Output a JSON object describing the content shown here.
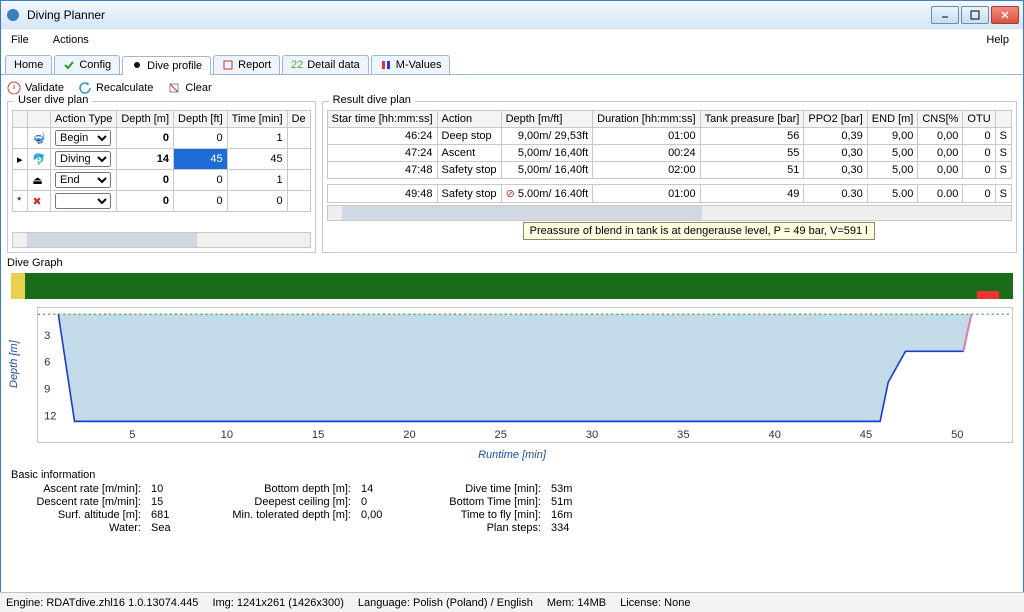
{
  "window": {
    "title": "Diving Planner"
  },
  "menu": {
    "file": "File",
    "actions": "Actions",
    "help": "Help"
  },
  "tabs": {
    "home": "Home",
    "config": "Config",
    "dive_profile": "Dive profile",
    "report": "Report",
    "detail_data": "Detail data",
    "mvalues": "M-Values"
  },
  "toolbar": {
    "validate": "Validate",
    "recalculate": "Recalculate",
    "clear": "Clear"
  },
  "user_plan": {
    "title": "User dive plan",
    "cols": {
      "action_type": "Action Type",
      "depth_m": "Depth [m]",
      "depth_ft": "Depth [ft]",
      "time_min": "Time [min]",
      "de": "De"
    },
    "rows": [
      {
        "action": "Begin",
        "depth_m": "0",
        "depth_ft": "0",
        "time": "1"
      },
      {
        "action": "Diving",
        "depth_m": "14",
        "depth_ft": "45",
        "time": "45"
      },
      {
        "action": "End",
        "depth_m": "0",
        "depth_ft": "0",
        "time": "1"
      },
      {
        "action": "",
        "depth_m": "0",
        "depth_ft": "0",
        "time": "0"
      }
    ]
  },
  "result_plan": {
    "title": "Result dive plan",
    "cols": {
      "star": "Star time [hh:mm:ss]",
      "action": "Action",
      "depth": "Depth [m/ft]",
      "duration": "Duration [hh:mm:ss]",
      "tank": "Tank preasure [bar]",
      "ppo2": "PPO2 [bar]",
      "end": "END [m]",
      "cns": "CNS[%",
      "otu": "OTU",
      "last": ""
    },
    "rows": [
      {
        "star": "46:24",
        "action": "Deep stop",
        "depth": "9,00m/ 29,53ft",
        "dur": "01:00",
        "tank": "56",
        "ppo2": "0,39",
        "end": "9,00",
        "cns": "0,00",
        "otu": "0",
        "l": "S"
      },
      {
        "star": "47:24",
        "action": "Ascent",
        "depth": "5,00m/ 16,40ft",
        "dur": "00:24",
        "tank": "55",
        "ppo2": "0,30",
        "end": "5,00",
        "cns": "0,00",
        "otu": "0",
        "l": "S"
      },
      {
        "star": "47:48",
        "action": "Safety stop",
        "depth": "5,00m/ 16,40ft",
        "dur": "02:00",
        "tank": "51",
        "ppo2": "0,30",
        "end": "5,00",
        "cns": "0,00",
        "otu": "0",
        "l": "S"
      },
      {
        "star": "49:48",
        "action": "Safety stop",
        "depth": "5.00m/ 16.40ft",
        "dur": "01:00",
        "tank": "49",
        "ppo2": "0.30",
        "end": "5.00",
        "cns": "0.00",
        "otu": "0",
        "l": "S",
        "warn": true
      }
    ]
  },
  "tooltip": "Preassure of blend in tank is at dengerause level, P = 49 bar, V=591 l",
  "graph": {
    "title": "Dive Graph",
    "ylabel": "Depth [m]",
    "xlabel": "Runtime [min]",
    "yticks": [
      "3",
      "6",
      "9",
      "12"
    ],
    "xticks": [
      "5",
      "10",
      "15",
      "20",
      "25",
      "30",
      "35",
      "40",
      "45",
      "50"
    ]
  },
  "basic": {
    "title": "Basic information",
    "items": {
      "ascent_rate_l": "Ascent rate [m/min]:",
      "ascent_rate_v": "10",
      "descent_rate_l": "Descent rate [m/min]:",
      "descent_rate_v": "15",
      "surf_alt_l": "Surf. altitude [m]:",
      "surf_alt_v": "681",
      "water_l": "Water:",
      "water_v": "Sea",
      "bottom_depth_l": "Bottom depth [m]:",
      "bottom_depth_v": "14",
      "deepest_ceil_l": "Deepest ceiling [m]:",
      "deepest_ceil_v": "0",
      "min_tol_l": "Min. tolerated depth [m]:",
      "min_tol_v": "0,00",
      "dive_time_l": "Dive time [min]:",
      "dive_time_v": "53m",
      "bottom_time_l": "Bottom Time [min]:",
      "bottom_time_v": "51m",
      "time_to_fly_l": "Time to fly [min]:",
      "time_to_fly_v": "16m",
      "plan_steps_l": "Plan steps:",
      "plan_steps_v": "334"
    }
  },
  "status": {
    "engine": "Engine: RDATdive.zhl16 1.0.13074.445",
    "img": "Img: 1241x261 (1426x300)",
    "lang": "Language: Polish (Poland) / English",
    "mem": "Mem: 14MB",
    "lic": "License: None"
  },
  "chart_data": {
    "type": "line",
    "title": "Dive Graph",
    "xlabel": "Runtime [min]",
    "ylabel": "Depth [m]",
    "xlim": [
      0,
      53
    ],
    "ylim": [
      14,
      0
    ],
    "yticks": [
      3,
      6,
      9,
      12
    ],
    "xticks": [
      5,
      10,
      15,
      20,
      25,
      30,
      35,
      40,
      45,
      50
    ],
    "series": [
      {
        "name": "depth",
        "x": [
          0,
          1,
          46,
          46.4,
          47.4,
          47.8,
          49.8,
          50.8,
          53
        ],
        "y": [
          0,
          14,
          14,
          9,
          5,
          5,
          5,
          5,
          0
        ]
      }
    ]
  }
}
